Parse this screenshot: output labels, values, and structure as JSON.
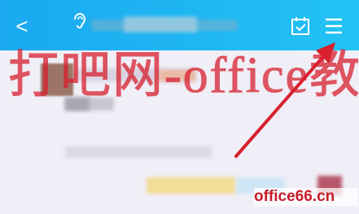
{
  "header": {
    "back_label": "<",
    "calendar_icon": "calendar-check-icon",
    "menu_icon": "hamburger-menu-icon",
    "ear_icon": "ear-icon",
    "bar_color": "#1fb6f2"
  },
  "watermark": {
    "text": "打吧网-office教程网",
    "color": "#d8202e"
  },
  "brand": {
    "text": "office66.cn"
  },
  "annotation": {
    "arrow_color": "#d8202e"
  }
}
